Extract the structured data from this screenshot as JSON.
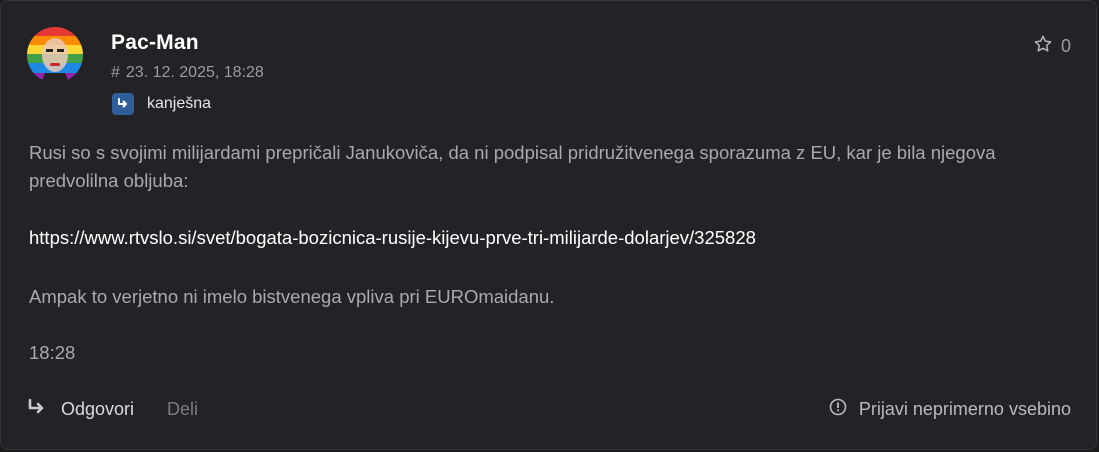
{
  "post": {
    "author": "Pac-Man",
    "hash": "#",
    "timestamp": "23. 12. 2025, 18:28",
    "badge_label": "kanješna",
    "likes": "0",
    "paragraph1": "Rusi so s svojimi milijardami prepričali Janukoviča, da ni podpisal pridružitvenega sporazuma z EU, kar je bila njegova predvolilna obljuba:",
    "link": "https://www.rtvslo.si/svet/bogata-bozicnica-rusije-kijevu-prve-tri-milijarde-dolarjev/325828",
    "paragraph3": "Ampak to verjetno ni imelo bistvenega vpliva pri EUROmaidanu.",
    "paragraph4": "18:28"
  },
  "footer": {
    "reply_label": "Odgovori",
    "share_label": "Deli",
    "report_label": "Prijavi neprimerno vsebino"
  },
  "icons": {
    "star": "star-icon",
    "reply": "reply-arrow-icon",
    "report": "info-circle-icon",
    "badge": "reply-badge-icon"
  },
  "colors": {
    "background": "#232327",
    "badge": "#2f5f9a",
    "text": "#a9a9ae",
    "link": "#ffffff"
  }
}
